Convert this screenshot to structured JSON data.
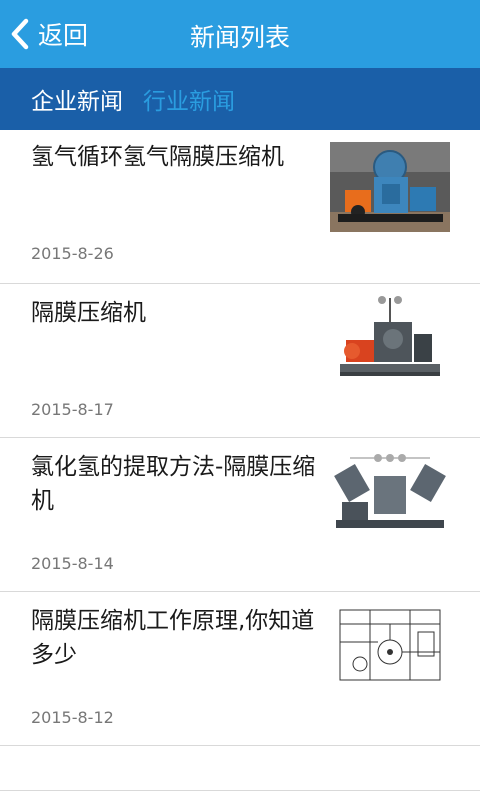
{
  "header": {
    "back_label": "返回",
    "title": "新闻列表",
    "back_icon": "chevron-left-icon"
  },
  "tabs": [
    {
      "label": "企业新闻",
      "active": false
    },
    {
      "label": "行业新闻",
      "active": true
    }
  ],
  "news": [
    {
      "title": "氢气循环氢气隔膜压缩机",
      "date": "2015-8-26",
      "image": "compressor-photo"
    },
    {
      "title": "隔膜压缩机",
      "date": "2015-8-17",
      "image": "compressor-photo"
    },
    {
      "title": "氯化氢的提取方法-隔膜压缩机",
      "date": "2015-8-14",
      "image": "compressor-photo"
    },
    {
      "title": "隔膜压缩机工作原理,你知道多少",
      "date": "2015-8-12",
      "image": "schematic-diagram"
    }
  ],
  "colors": {
    "header_bg": "#2a9de0",
    "tabbar_bg": "#1a5fa8",
    "active_tab": "#2a9de0"
  }
}
